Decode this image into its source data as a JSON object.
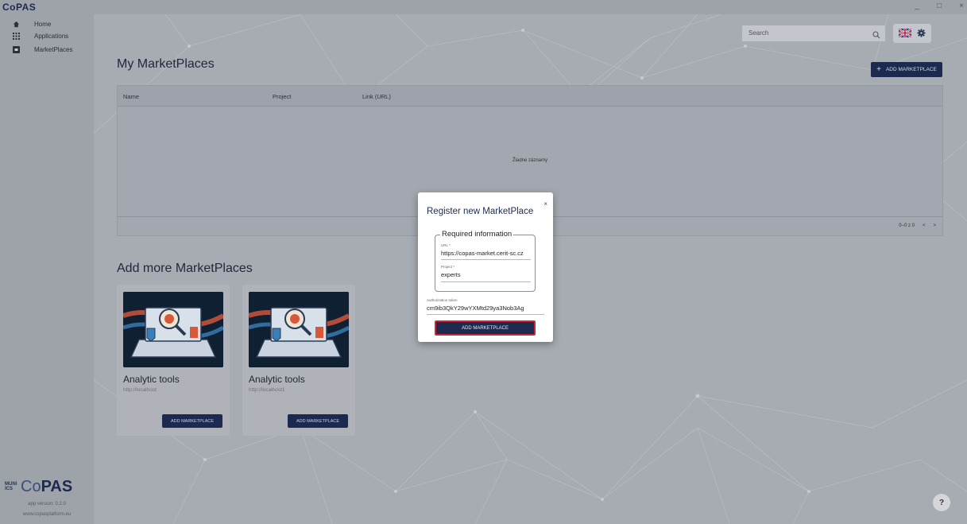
{
  "app": {
    "brand_small": "CoPAS",
    "window_controls": [
      "_",
      "□",
      "×"
    ]
  },
  "sidebar": {
    "items": [
      {
        "label": "Home",
        "icon": "home-icon"
      },
      {
        "label": "Applications",
        "icon": "grid-icon"
      },
      {
        "label": "MarketPlaces",
        "icon": "marketplace-icon"
      }
    ],
    "footer": {
      "muni_logo": "MUNI ICS",
      "logo_co": "Co",
      "logo_pas": "PAS",
      "version": "app version: 0.2.0",
      "copyright": "www.copasplatform.eu"
    }
  },
  "header": {
    "search_placeholder": "Search"
  },
  "page": {
    "title": "My MarketPlaces",
    "add_button_label": "ADD MARKETPLACE"
  },
  "table": {
    "columns": [
      "Name",
      "Project",
      "Link (URL)"
    ],
    "empty_text": "Žiadne záznamy",
    "pagination": "0–0 z 0"
  },
  "more": {
    "title": "Add more MarketPlaces",
    "cards": [
      {
        "title": "Analytic tools",
        "url": "http://localhost",
        "button": "ADD MARKETPLACE"
      },
      {
        "title": "Analytic tools",
        "url": "http://localhost1",
        "button": "ADD MARKETPLACE"
      }
    ]
  },
  "modal": {
    "title": "Register new MarketPlace",
    "close": "×",
    "fieldset_legend": "Required information",
    "url_label": "URL *",
    "url_value": "https://copas-market.cerit-sc.cz",
    "project_label": "Project *",
    "project_value": "experts",
    "token_label": "Authorization token",
    "token_value": "cm9ib3QkY29wYXMtd29ya3Nob3Ag",
    "submit_label": "ADD MARKETPLACE"
  },
  "help": "?",
  "colors": {
    "primary": "#1b2a4e",
    "highlight_border": "#d0233a",
    "overlay_bg": "#a7acb3"
  }
}
